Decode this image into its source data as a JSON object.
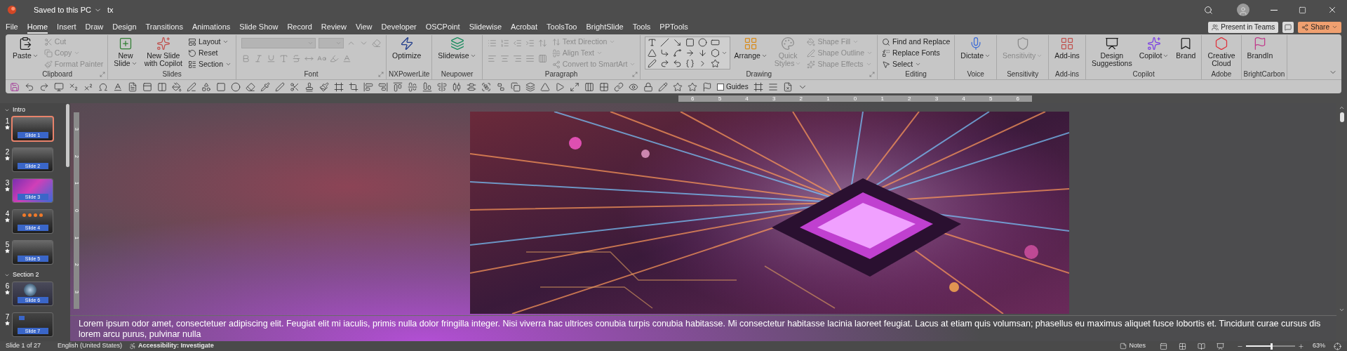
{
  "title_bar": {
    "status": "Saved to this PC",
    "file_name": "tx"
  },
  "tabs": [
    {
      "label": "File",
      "selected": false
    },
    {
      "label": "Home",
      "selected": true
    },
    {
      "label": "Insert",
      "selected": false
    },
    {
      "label": "Draw",
      "selected": false
    },
    {
      "label": "Design",
      "selected": false
    },
    {
      "label": "Transitions",
      "selected": false
    },
    {
      "label": "Animations",
      "selected": false
    },
    {
      "label": "Slide Show",
      "selected": false
    },
    {
      "label": "Record",
      "selected": false
    },
    {
      "label": "Review",
      "selected": false
    },
    {
      "label": "View",
      "selected": false
    },
    {
      "label": "Developer",
      "selected": false
    },
    {
      "label": "OSCPoint",
      "selected": false
    },
    {
      "label": "Slidewise",
      "selected": false
    },
    {
      "label": "Acrobat",
      "selected": false
    },
    {
      "label": "ToolsToo",
      "selected": false
    },
    {
      "label": "BrightSlide",
      "selected": false
    },
    {
      "label": "Tools",
      "selected": false
    },
    {
      "label": "PPTools",
      "selected": false
    }
  ],
  "header_buttons": {
    "present": "Present in Teams",
    "share": "Share"
  },
  "ribbon": {
    "groups": [
      {
        "label": "Clipboard",
        "launcher": true,
        "items": [
          {
            "kind": "large",
            "lines": [
              "Paste"
            ],
            "dropdown": true,
            "disabled": false
          },
          {
            "kind": "stack",
            "items": [
              {
                "label": "Cut",
                "disabled": true,
                "dropdown": false
              },
              {
                "label": "Copy",
                "disabled": true,
                "dropdown": true
              },
              {
                "label": "Format Painter",
                "disabled": true,
                "dropdown": false
              }
            ]
          }
        ]
      },
      {
        "label": "Slides",
        "launcher": false,
        "items": [
          {
            "kind": "large",
            "lines": [
              "New",
              "Slide"
            ],
            "dropdown": true,
            "disabled": false
          },
          {
            "kind": "large",
            "lines": [
              "New Slide",
              "with Copilot"
            ],
            "dropdown": false,
            "disabled": false
          },
          {
            "kind": "stack",
            "items": [
              {
                "label": "Layout",
                "disabled": false,
                "dropdown": true
              },
              {
                "label": "Reset",
                "disabled": false,
                "dropdown": false
              },
              {
                "label": "Section",
                "disabled": false,
                "dropdown": true
              }
            ]
          }
        ]
      },
      {
        "label": "Font",
        "launcher": true,
        "items": [
          {
            "kind": "font-tools",
            "disabled": true
          }
        ]
      },
      {
        "label": "NXPowerLite",
        "launcher": false,
        "items": [
          {
            "kind": "large",
            "lines": [
              "Optimize"
            ],
            "dropdown": false,
            "disabled": false
          }
        ]
      },
      {
        "label": "Neupower",
        "launcher": false,
        "items": [
          {
            "kind": "large",
            "lines": [
              "Slidewise"
            ],
            "dropdown": true,
            "disabled": false
          }
        ]
      },
      {
        "label": "Paragraph",
        "launcher": true,
        "items": [
          {
            "kind": "paragraph-tools",
            "disabled": true
          },
          {
            "kind": "stack",
            "items": [
              {
                "label": "Text Direction",
                "disabled": true,
                "dropdown": true
              },
              {
                "label": "Align Text",
                "disabled": true,
                "dropdown": true
              },
              {
                "label": "Convert to SmartArt",
                "disabled": true,
                "dropdown": true
              }
            ]
          }
        ]
      },
      {
        "label": "Drawing",
        "launcher": true,
        "items": [
          {
            "kind": "shape-gallery",
            "disabled": false
          },
          {
            "kind": "large",
            "lines": [
              "Arrange"
            ],
            "dropdown": true,
            "disabled": false
          },
          {
            "kind": "large",
            "lines": [
              "Quick",
              "Styles"
            ],
            "dropdown": true,
            "disabled": true
          },
          {
            "kind": "stack",
            "items": [
              {
                "label": "Shape Fill",
                "disabled": true,
                "dropdown": true
              },
              {
                "label": "Shape Outline",
                "disabled": true,
                "dropdown": true
              },
              {
                "label": "Shape Effects",
                "disabled": true,
                "dropdown": true
              }
            ]
          }
        ]
      },
      {
        "label": "Editing",
        "launcher": false,
        "items": [
          {
            "kind": "stack",
            "items": [
              {
                "label": "Find and Replace",
                "disabled": false,
                "dropdown": false
              },
              {
                "label": "Replace Fonts",
                "disabled": false,
                "dropdown": false
              },
              {
                "label": "Select",
                "disabled": false,
                "dropdown": true
              }
            ]
          }
        ]
      },
      {
        "label": "Voice",
        "launcher": false,
        "items": [
          {
            "kind": "large",
            "lines": [
              "Dictate"
            ],
            "dropdown": true,
            "disabled": false
          }
        ]
      },
      {
        "label": "Sensitivity",
        "launcher": false,
        "items": [
          {
            "kind": "large",
            "lines": [
              "Sensitivity"
            ],
            "dropdown": true,
            "disabled": true
          }
        ]
      },
      {
        "label": "Add-ins",
        "launcher": false,
        "items": [
          {
            "kind": "large",
            "lines": [
              "Add-ins"
            ],
            "dropdown": false,
            "disabled": false
          }
        ]
      },
      {
        "label": "Copilot",
        "launcher": false,
        "items": [
          {
            "kind": "large",
            "lines": [
              "Design",
              "Suggestions"
            ],
            "dropdown": false,
            "disabled": false
          },
          {
            "kind": "large",
            "lines": [
              "Copilot"
            ],
            "dropdown": true,
            "disabled": false
          },
          {
            "kind": "large",
            "lines": [
              "Brand"
            ],
            "dropdown": false,
            "disabled": false
          }
        ]
      },
      {
        "label": "Adobe",
        "launcher": false,
        "items": [
          {
            "kind": "large",
            "lines": [
              "Creative",
              "Cloud"
            ],
            "dropdown": false,
            "disabled": false
          }
        ]
      },
      {
        "label": "BrightCarbon",
        "launcher": false,
        "items": [
          {
            "kind": "large",
            "lines": [
              "BrandIn"
            ],
            "dropdown": false,
            "disabled": false
          }
        ]
      }
    ]
  },
  "quick_access": {
    "guides": {
      "label": "Guides",
      "checked": false
    }
  },
  "ruler": {
    "horizontal": [
      "6",
      "5",
      "4",
      "3",
      "2",
      "1",
      "0",
      "1",
      "2",
      "3",
      "4",
      "5",
      "6"
    ],
    "vertical": [
      "3",
      "2",
      "1",
      "0",
      "1",
      "2",
      "3"
    ]
  },
  "slide_panel": {
    "sections": [
      {
        "title": "Intro",
        "expanded": true,
        "slides": [
          {
            "number": "1",
            "label": "Slide 1",
            "selected": true,
            "kind": "floor"
          },
          {
            "number": "2",
            "label": "Slide 2",
            "selected": false,
            "kind": "floor"
          },
          {
            "number": "3",
            "label": "Slide 3",
            "selected": false,
            "kind": "smoke"
          },
          {
            "number": "4",
            "label": "Slide 4",
            "selected": false,
            "kind": "dots"
          },
          {
            "number": "5",
            "label": "Slide 5",
            "selected": false,
            "kind": "floor"
          }
        ]
      },
      {
        "title": "Section 2",
        "expanded": true,
        "slides": [
          {
            "number": "6",
            "label": "Slide 6",
            "selected": false,
            "kind": "orb"
          },
          {
            "number": "7",
            "label": "Slide 7",
            "selected": false,
            "kind": "square"
          }
        ]
      }
    ]
  },
  "notes": {
    "text": "Lorem ipsum odor amet, consectetuer adipiscing elit. Feugiat elit mi iaculis, primis nulla dolor fringilla integer. Nisi viverra hac ultrices conubia turpis conubia habitasse. Mi consectetur habitasse lacinia laoreet feugiat. Lacus at etiam quis volumsan; phasellus eu maximus aliquet fusce lobortis et. Tincidunt curae cursus dis lorem arcu purus, pulvinar nulla"
  },
  "status_bar": {
    "slide_count": "Slide 1 of 27",
    "language": "English (United States)",
    "accessibility": "Accessibility: Investigate",
    "notes": "Notes",
    "zoom": {
      "level": 0.5,
      "reading": "63%"
    }
  }
}
